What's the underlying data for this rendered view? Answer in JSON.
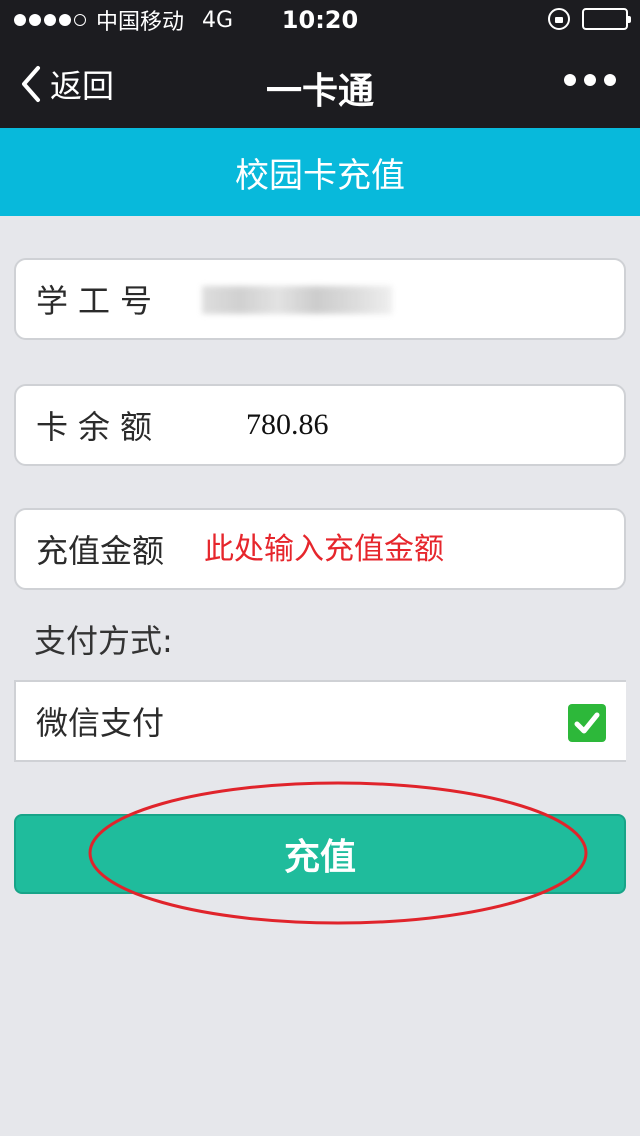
{
  "status_bar": {
    "carrier": "中国移动",
    "network": "4G",
    "time": "10:20"
  },
  "nav": {
    "back_label": "返回",
    "title": "一卡通"
  },
  "header": {
    "title": "校园卡充值"
  },
  "form": {
    "student_id_label": "学工号",
    "balance_label": "卡余额",
    "balance_value": "780.86",
    "amount_label": "充值金额",
    "amount_placeholder": "此处输入充值金额"
  },
  "payment": {
    "section_label": "支付方式:",
    "option_label": "微信支付",
    "option_checked": true
  },
  "actions": {
    "recharge_label": "充值"
  },
  "colors": {
    "nav_background": "#1c1c20",
    "header_background": "#08b9db",
    "button_background": "#1fbc9c",
    "placeholder_text": "#e6262c",
    "checkbox": "#2db83a",
    "annotation_circle": "#e0242b"
  }
}
